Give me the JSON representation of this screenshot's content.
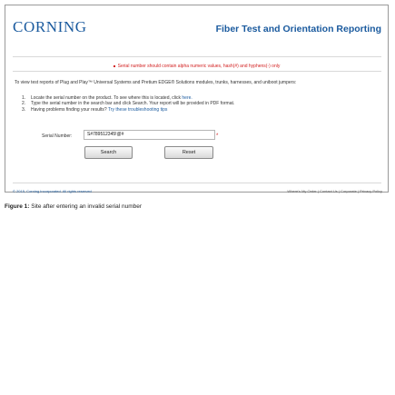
{
  "header": {
    "logo_text": "CORNING",
    "site_title": "Fiber Test and Orientation Reporting"
  },
  "error_message": "Serial number should contain alpha numeric values, hash(#) and hyphens(-) only",
  "intro_text": "To view test reports of Plug and Play™ Universal Systems and Pretium EDGE® Solutions modules, trunks, harnesses, and uniboot jumpers:",
  "steps": [
    {
      "num": "1.",
      "text": "Locate the serial number on the product. To see where this is located, click ",
      "link": "here."
    },
    {
      "num": "2.",
      "text": "Type the serial number in the search bar and click Search. Your report will be provided in PDF format.",
      "link": ""
    },
    {
      "num": "3.",
      "text": "Having problems finding your results? ",
      "link": "Try these troubleshooting tips"
    }
  ],
  "form": {
    "serial_label": "Serial Number:",
    "serial_value": "S#789512345!@#",
    "required_marker": "*",
    "search_label": "Search",
    "reset_label": "Reset"
  },
  "footer": {
    "copyright": "© 2015, Corning Incorporated. All rights reserved",
    "links": "Where's My Order | Contact Us | Corporate | Privacy Policy"
  },
  "caption": {
    "label": "Figure 1:",
    "text": " Site after entering an invalid serial number"
  },
  "colors": {
    "brand": "#1a5a9e",
    "error": "#d21f1f"
  }
}
